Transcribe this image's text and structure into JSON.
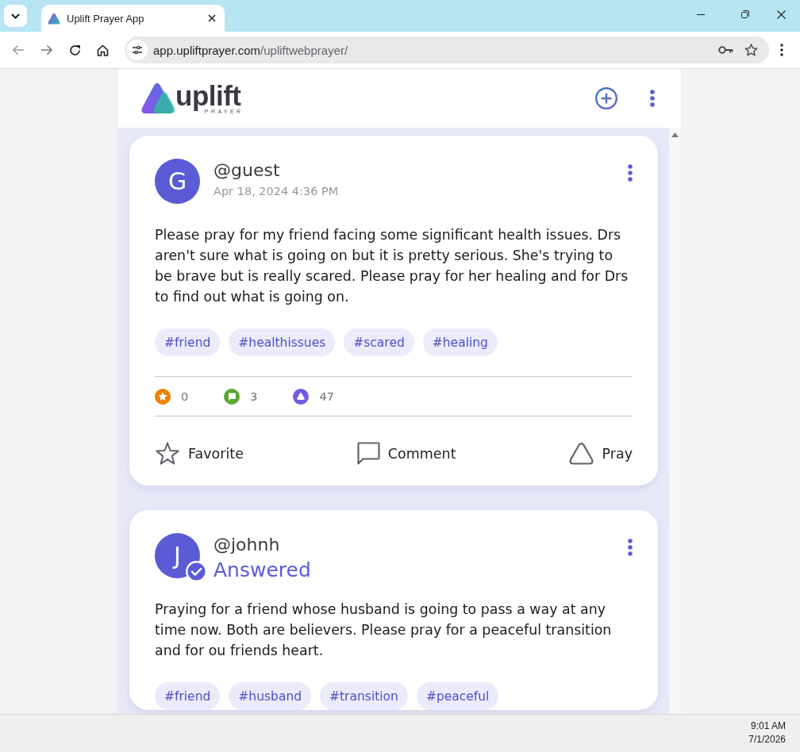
{
  "browser": {
    "tab_title": "Uplift Prayer App",
    "url_host": "app.upliftprayer.com",
    "url_path": "/upliftwebprayer/"
  },
  "app_header": {
    "logo_text": "uplift",
    "logo_tagline": "PRAYER"
  },
  "posts": [
    {
      "avatar_letter": "G",
      "username": "@guest",
      "answered": false,
      "subtitle": "Apr 18, 2024 4:36 PM",
      "text": "Please pray for my friend facing some significant health issues. Drs aren't sure what is going on but it is pretty serious. She's trying to be brave but is really scared. Please pray for her healing and for Drs to find out what is going on.",
      "tags": [
        "#friend",
        "#healthissues",
        "#scared",
        "#healing"
      ],
      "stats": [
        {
          "kind": "favorites",
          "count": "0",
          "color": "#f08000"
        },
        {
          "kind": "comments",
          "count": "3",
          "color": "#5aa832"
        },
        {
          "kind": "prayers",
          "count": "47",
          "color": "#7759e2"
        }
      ],
      "actions": [
        {
          "kind": "favorite",
          "label": "Favorite"
        },
        {
          "kind": "comment",
          "label": "Comment"
        },
        {
          "kind": "pray",
          "label": "Pray"
        }
      ]
    },
    {
      "avatar_letter": "J",
      "username": "@johnh",
      "answered": true,
      "subtitle": "Answered",
      "text": "Praying for a friend whose husband is going to pass a way at any time now. Both are believers. Please pray for a peaceful transition and for ou friends heart.",
      "tags": [
        "#friend",
        "#husband",
        "#transition",
        "#peaceful"
      ]
    }
  ],
  "taskbar": {
    "time": "9:01 AM",
    "date": "7/1/2026"
  }
}
